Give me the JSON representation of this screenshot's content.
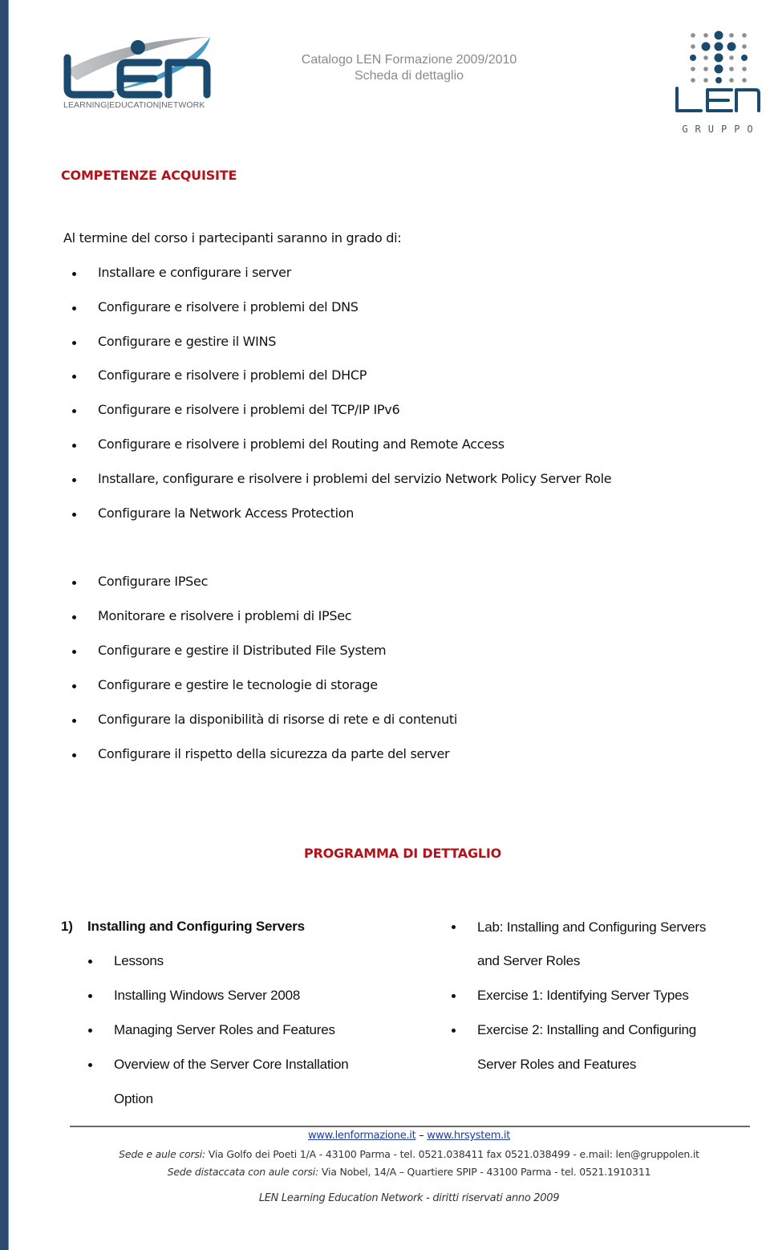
{
  "header": {
    "logo_left": {
      "letters": "LEN",
      "tagline": "LEARNING|EDUCATION|NETWORK"
    },
    "title_line1": "Catalogo LEN Formazione 2009/2010",
    "title_line2": "Scheda di dettaglio",
    "logo_right": {
      "letters": "LEN",
      "subtitle": "GRUPPO"
    }
  },
  "colors": {
    "accent_red": "#b3121a",
    "brand_blue": "#1a4a6e",
    "left_bar": "#2c4a6e",
    "link_blue": "#1f3f9a"
  },
  "competenze": {
    "heading": "COMPETENZE ACQUISITE",
    "intro": "Al termine del corso i partecipanti saranno in grado di:",
    "items": [
      "Installare e configurare i server",
      "Configurare e risolvere i problemi del DNS",
      "Configurare e gestire il WINS",
      "Configurare e risolvere i problemi del DHCP",
      "Configurare e risolvere i problemi del TCP/IP IPv6",
      "Configurare e risolvere i problemi del Routing and Remote Access",
      "Installare, configurare e risolvere i problemi del servizio Network Policy Server Role",
      "Configurare la Network Access Protection",
      "Configurare IPSec",
      "Monitorare e risolvere i problemi di IPSec",
      "Configurare e gestire il Distributed File System",
      "Configurare e gestire le tecnologie di storage",
      "Configurare la disponibilità di risorse di rete e di contenuti",
      "Configurare il rispetto della sicurezza da parte del server"
    ]
  },
  "programma": {
    "heading": "PROGRAMMA DI DETTAGLIO",
    "module_number": "1)",
    "module_title": "Installing and Configuring Servers",
    "left_items": [
      "Lessons",
      "Installing Windows Server 2008",
      "Managing Server Roles and Features",
      "Overview of the Server Core Installation",
      "Option"
    ],
    "right_items": [
      "Lab: Installing and Configuring Servers",
      "and Server Roles",
      "Exercise 1: Identifying Server Types",
      "Exercise 2: Installing and Configuring",
      "Server Roles and Features"
    ]
  },
  "footer": {
    "link1": "www.lenformazione.it",
    "separator": " – ",
    "link2": "www.hrsystem.it",
    "line1_label": "Sede e aule corsi:",
    "line1_text": " Via Golfo dei Poeti 1/A - 43100 Parma -  tel. 0521.038411 fax 0521.038499 - e.mail: len@gruppolen.it",
    "line2_label": "Sede distaccata con aule corsi:",
    "line2_text": " Via  Nobel, 14/A – Quartiere SPIP - 43100 Parma - tel. 0521.1910311",
    "copyright": "LEN Learning Education Network  - diritti riservati anno 2009"
  }
}
